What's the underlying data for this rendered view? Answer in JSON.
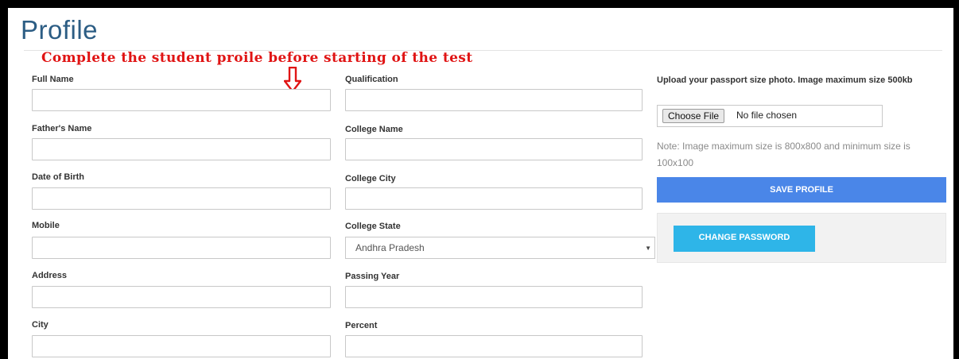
{
  "page": {
    "title": "Profile",
    "annotation": "Complete the student proile before starting of the test"
  },
  "left_column": [
    {
      "label": "Full Name",
      "value": ""
    },
    {
      "label": "Father's Name",
      "value": ""
    },
    {
      "label": "Date of Birth",
      "value": ""
    },
    {
      "label": "Mobile",
      "value": ""
    },
    {
      "label": "Address",
      "value": ""
    },
    {
      "label": "City",
      "value": ""
    }
  ],
  "middle_column": {
    "qualification": {
      "label": "Qualification",
      "value": ""
    },
    "college_name": {
      "label": "College Name",
      "value": ""
    },
    "college_city": {
      "label": "College City",
      "value": ""
    },
    "college_state": {
      "label": "College State",
      "selected": "Andhra Pradesh"
    },
    "passing_year": {
      "label": "Passing Year",
      "value": ""
    },
    "percent": {
      "label": "Percent",
      "value": ""
    }
  },
  "upload": {
    "label": "Upload your passport size photo. Image maximum size 500kb",
    "choose_button": "Choose File",
    "status": "No file chosen",
    "note": "Note: Image maximum size is 800x800 and minimum size is 100x100"
  },
  "actions": {
    "save": "SAVE PROFILE",
    "change_password": "CHANGE PASSWORD"
  },
  "colors": {
    "title": "#2c5d84",
    "annotation": "#e01414",
    "save_button": "#4a86e8",
    "password_button": "#2eb5e8"
  },
  "icons": {
    "annotation_arrow": "down-arrow-icon",
    "select_caret": "caret-down-icon"
  }
}
